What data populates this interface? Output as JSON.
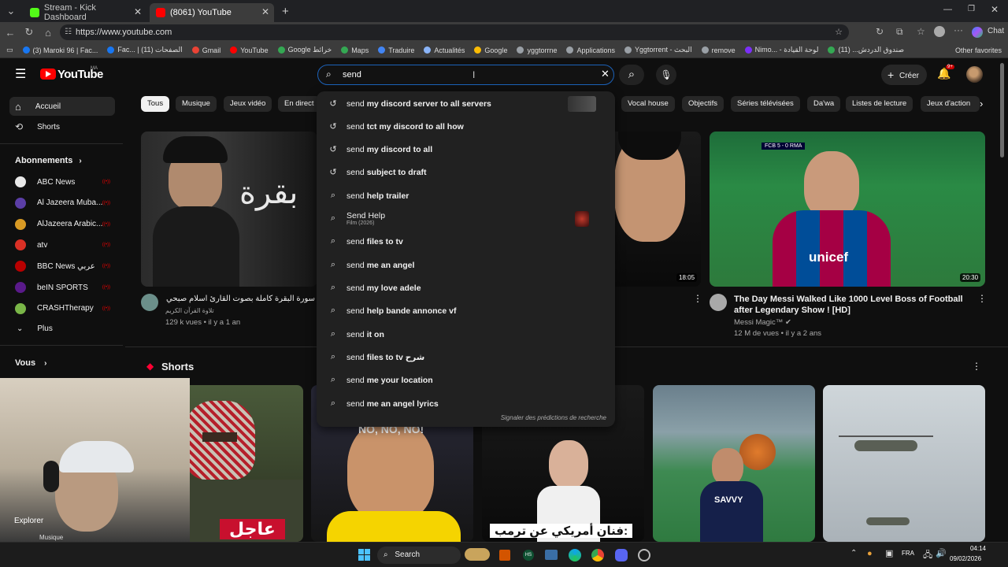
{
  "browser": {
    "tabs": [
      {
        "title": "Stream - Kick Dashboard",
        "color": "#53fc18"
      },
      {
        "title": "(8061) YouTube",
        "color": "#ff0000"
      }
    ],
    "url": "https://www.youtube.com",
    "chat_label": "Chat",
    "bookmarks": [
      {
        "label": "(3) Maroki 96 | Fac...",
        "color": "#1877f2"
      },
      {
        "label": "Fac... | الصفحات (11)",
        "color": "#1877f2"
      },
      {
        "label": "Gmail",
        "color": "#ea4335"
      },
      {
        "label": "YouTube",
        "color": "#ff0000"
      },
      {
        "label": "Google خرائط",
        "color": "#34a853"
      },
      {
        "label": "Maps",
        "color": "#34a853"
      },
      {
        "label": "Traduire",
        "color": "#4285f4"
      },
      {
        "label": "Actualités",
        "color": "#8ab4f8"
      },
      {
        "label": "Google",
        "color": "#fbbc05"
      },
      {
        "label": "yggtorrne",
        "color": "#9aa0a6"
      },
      {
        "label": "Applications",
        "color": "#9aa0a6"
      },
      {
        "label": "Yggtorrent - البحث",
        "color": "#9aa0a6"
      },
      {
        "label": "remove",
        "color": "#9aa0a6"
      },
      {
        "label": "Nimo... - لوحة القيادة",
        "color": "#7b2ff7"
      },
      {
        "label": "صندوق الدردش... (11)",
        "color": "#34a853"
      }
    ],
    "other_favorites": "Other favorites"
  },
  "youtube": {
    "logo": "YouTube",
    "logo_region": "MA",
    "search_value": "send",
    "create_label": "Créer",
    "notif_count": "9+"
  },
  "sidebar": {
    "home": "Accueil",
    "shorts": "Shorts",
    "subs_heading": "Abonnements",
    "subs": [
      {
        "name": "ABC News",
        "color": "#e8e8e8"
      },
      {
        "name": "Al Jazeera Muba...",
        "color": "#5b3ea6"
      },
      {
        "name": "AlJazeera Arabic...",
        "color": "#d89a24"
      },
      {
        "name": "atv",
        "color": "#d93025"
      },
      {
        "name": "BBC News عربي",
        "color": "#b80000"
      },
      {
        "name": "beIN SPORTS",
        "color": "#5a1a8a"
      },
      {
        "name": "CRASHTherapy",
        "color": "#7ab648"
      }
    ],
    "more": "Plus",
    "you": "Vous",
    "explore": "Explorer",
    "music": "Musique"
  },
  "chips": [
    "Tous",
    "Musique",
    "Jeux vidéo",
    "En direct",
    "Vocal house",
    "Objectifs",
    "Séries télévisées",
    "Da'wa",
    "Listes de lecture",
    "Jeux d'action"
  ],
  "suggestions": [
    {
      "prefix": "send",
      "rest": " my discord server to all servers",
      "icon": "history",
      "thumb": true
    },
    {
      "prefix": "send",
      "rest": " tct my discord to all how",
      "icon": "history"
    },
    {
      "prefix": "send",
      "rest": " my discord to all",
      "icon": "history"
    },
    {
      "prefix": "send",
      "rest": " subject to draft",
      "icon": "history"
    },
    {
      "prefix": "send",
      "rest": " help trailer",
      "icon": "search"
    },
    {
      "prefix": "Send Help",
      "rest": "",
      "sub": "Film (2026)",
      "icon": "search",
      "thumb2": true
    },
    {
      "prefix": "send",
      "rest": " files to tv",
      "icon": "search"
    },
    {
      "prefix": "send",
      "rest": " me an angel",
      "icon": "search"
    },
    {
      "prefix": "send",
      "rest": " my love adele",
      "icon": "search"
    },
    {
      "prefix": "send",
      "rest": " help bande annonce vf",
      "icon": "search"
    },
    {
      "prefix": "send",
      "rest": " it on",
      "icon": "search"
    },
    {
      "prefix": "send",
      "rest": " files to tv شرح",
      "icon": "search"
    },
    {
      "prefix": "send",
      "rest": " me your location",
      "icon": "search"
    },
    {
      "prefix": "send",
      "rest": " me an angel lyrics",
      "icon": "search"
    }
  ],
  "report_link": "Signaler des prédictions de recherche",
  "videos": {
    "v1": {
      "title": "سورة البقرة كاملة بصوت القارئ اسلام صبحي",
      "channel": "تلاوة القرآن الكريم",
      "meta": "129 k vues • il y a 1 an",
      "overlay": "بقرة"
    },
    "v3": {
      "duration": "18:05"
    },
    "v4": {
      "title": "The Day Messi Walked Like 1000 Level Boss of Football after Legendary Show ! [HD]",
      "channel": "Messi Magic™",
      "meta": "12 M de vues • il y a 2 ans",
      "duration": "20:30",
      "overlay_top": "FCB 5 - 0 RMA",
      "jersey": "unicef"
    }
  },
  "shorts_heading": "Shorts",
  "shorts_text": {
    "s1": "عاجل",
    "s2": "NO, NO, NO!",
    "s3": "فنان أمريكي عن ترمب:",
    "s4": "SAVVY"
  },
  "taskbar": {
    "search": "Search",
    "lang": "FRA",
    "time": "04:14",
    "date": "09/02/2026"
  }
}
